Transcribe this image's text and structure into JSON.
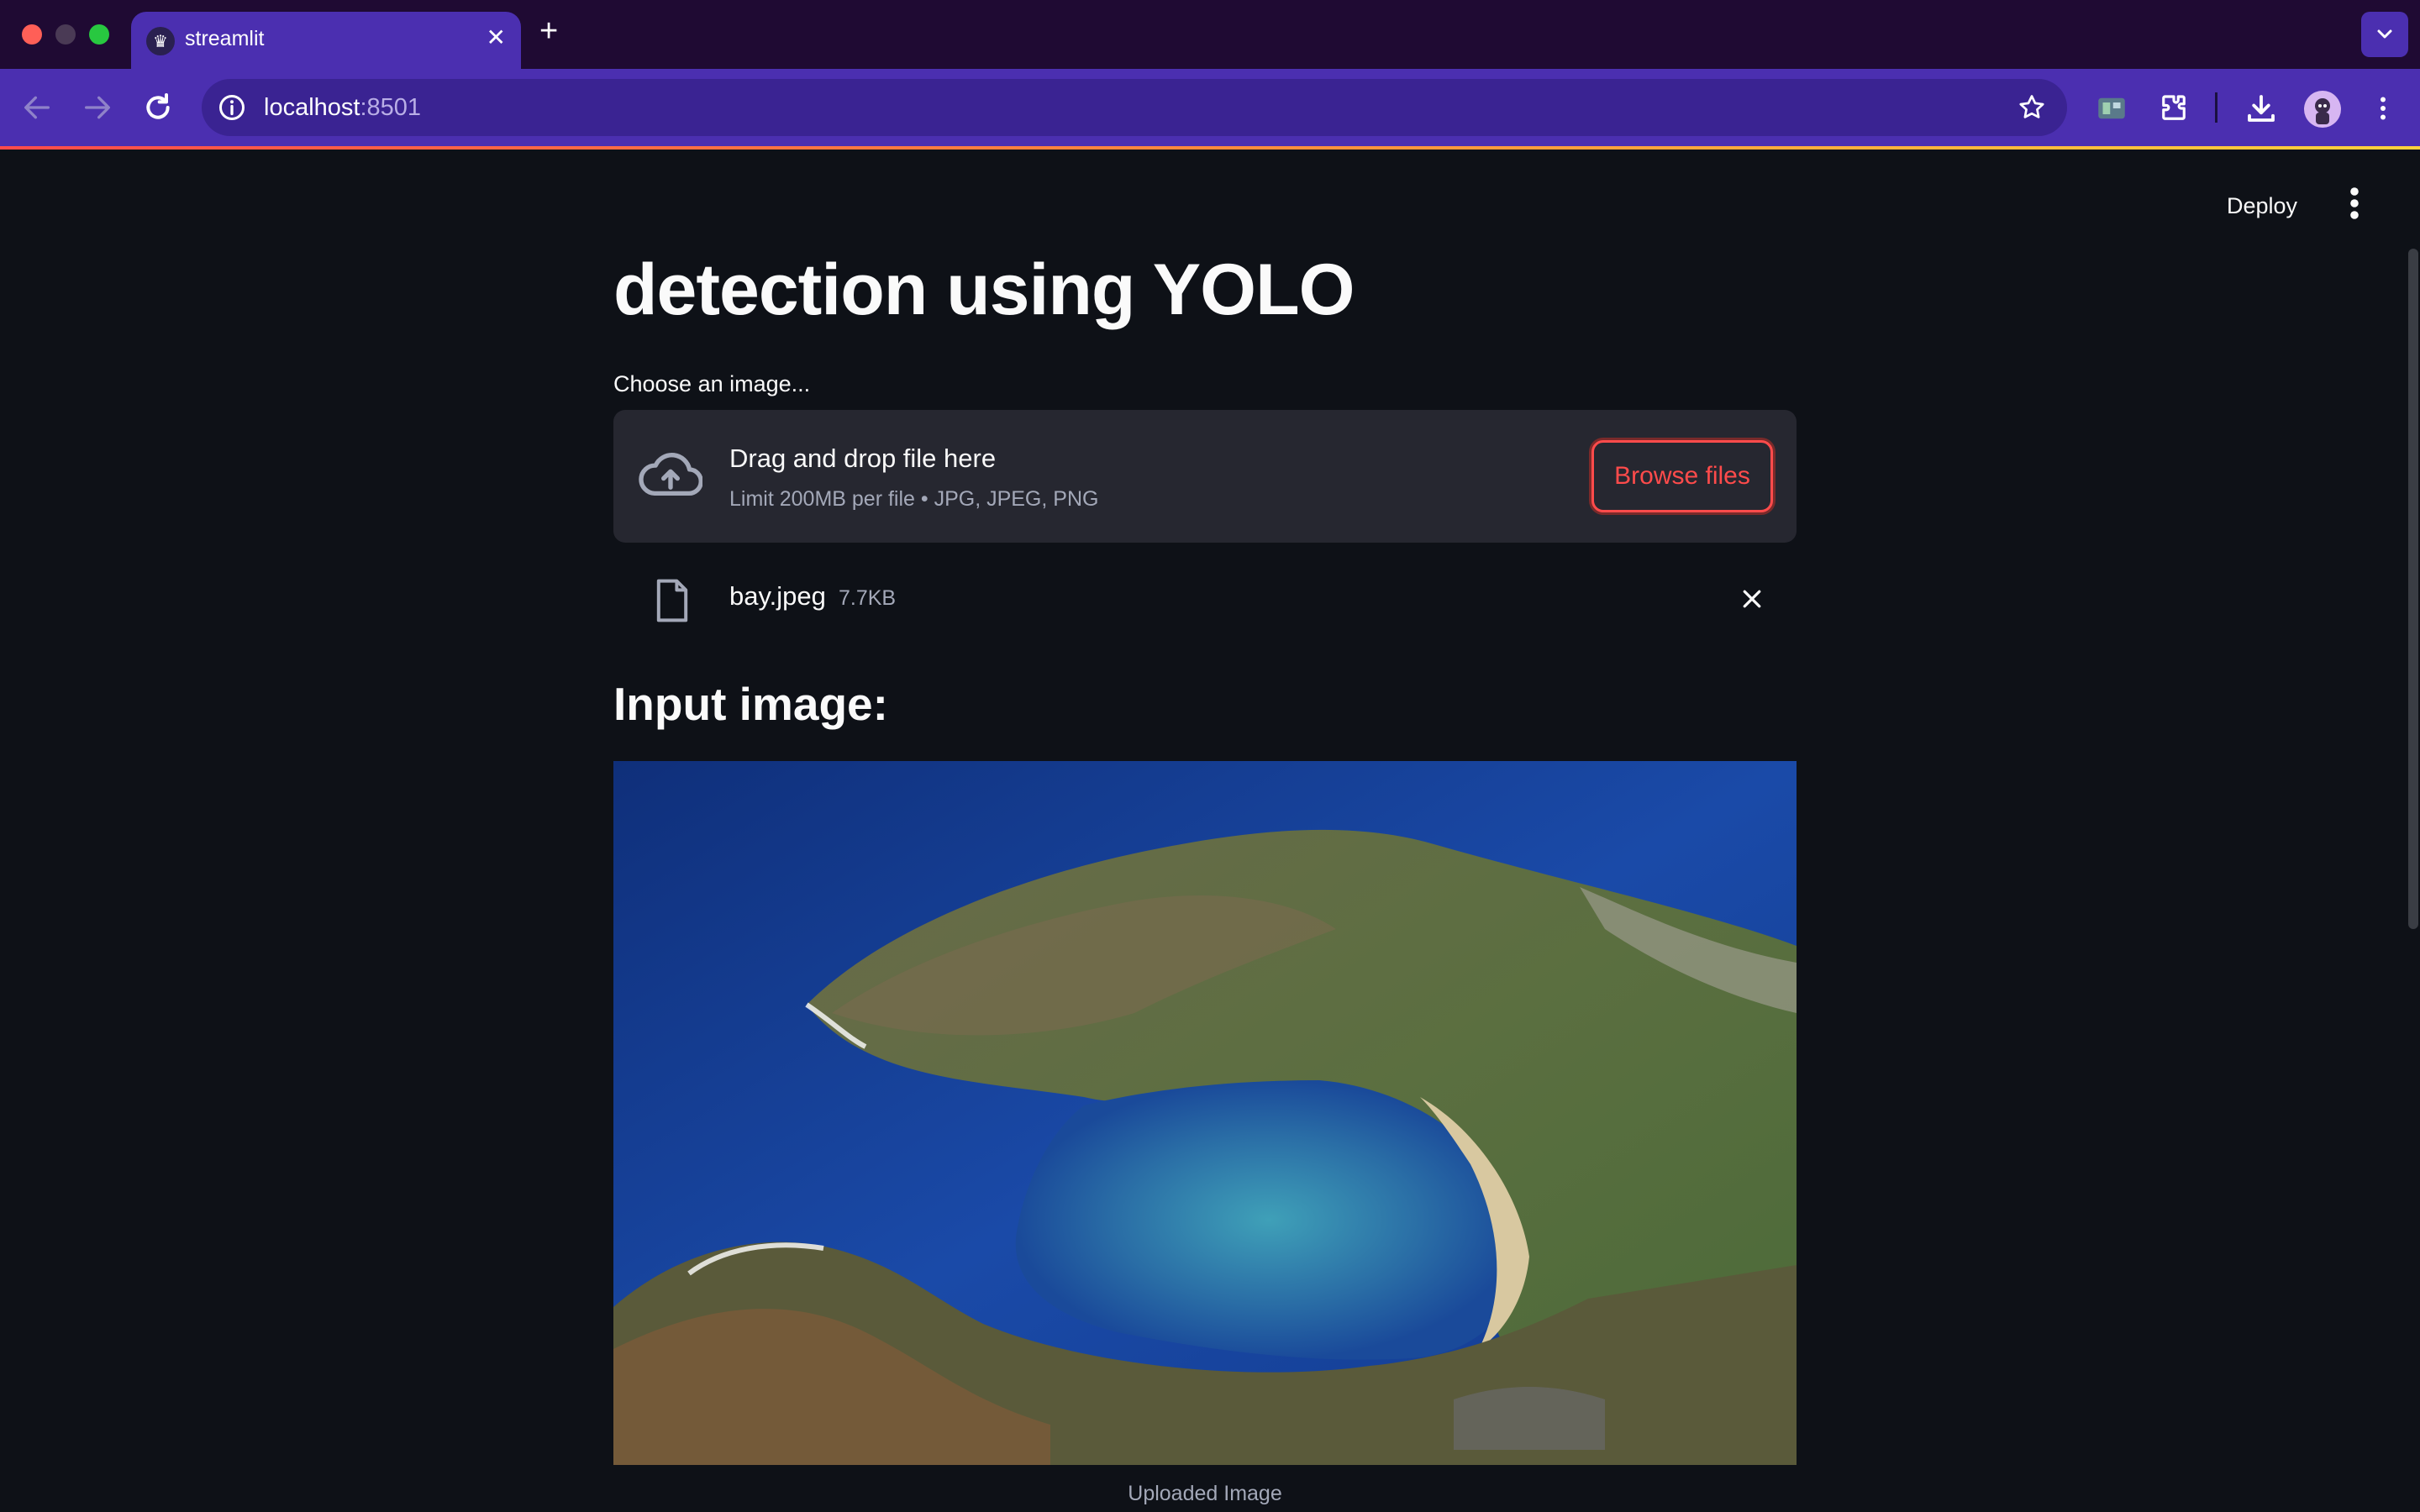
{
  "browser": {
    "tab_title": "streamlit",
    "url_host": "localhost",
    "url_port": ":8501"
  },
  "app": {
    "deploy_label": "Deploy",
    "title": "detection using YOLO",
    "uploader": {
      "label": "Choose an image...",
      "drop_title": "Drag and drop file here",
      "limit_text": "Limit 200MB per file • JPG, JPEG, PNG",
      "browse_label": "Browse files"
    },
    "file": {
      "name": "bay.jpeg",
      "size": "7.7KB"
    },
    "input_heading": "Input image:",
    "image_caption": "Uploaded Image"
  },
  "colors": {
    "accent": "#ff4b4b",
    "background": "#0e1117",
    "surface": "#262730",
    "browser_frame": "#4b2fb0"
  },
  "icons": [
    "close-icon",
    "plus-icon",
    "back-icon",
    "forward-icon",
    "reload-icon",
    "info-icon",
    "star-icon",
    "extension-icon",
    "download-icon",
    "more-vert-icon",
    "cloud-upload-icon",
    "file-icon",
    "chevron-down-icon"
  ]
}
